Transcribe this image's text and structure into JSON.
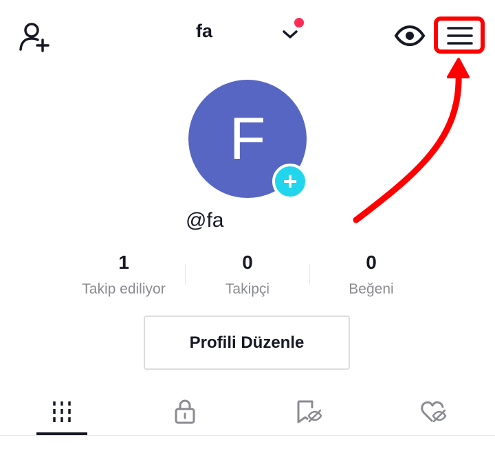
{
  "topbar": {
    "username": "fa",
    "add_friend_icon": "person-plus-icon",
    "account_switch_icon": "chevron-down-icon",
    "notification_dot_color": "#fe2c55",
    "views_icon": "eye-icon",
    "menu_icon": "hamburger-menu-icon"
  },
  "profile": {
    "avatar_initial": "F",
    "avatar_color": "#5766c2",
    "avatar_add_icon": "plus-icon",
    "avatar_add_symbol": "+",
    "handle": "@fa"
  },
  "stats": [
    {
      "value": "1",
      "label": "Takip ediliyor"
    },
    {
      "value": "0",
      "label": "Takipçi"
    },
    {
      "value": "0",
      "label": "Beğeni"
    }
  ],
  "edit_profile_label": "Profili Düzenle",
  "tabs": [
    {
      "icon": "grid-videos-icon",
      "active": true
    },
    {
      "icon": "lock-icon",
      "active": false
    },
    {
      "icon": "bookmark-hidden-icon",
      "active": false
    },
    {
      "icon": "heart-hidden-icon",
      "active": false
    }
  ],
  "annotation": {
    "highlight_color": "#ff0000",
    "target": "menu-button"
  }
}
